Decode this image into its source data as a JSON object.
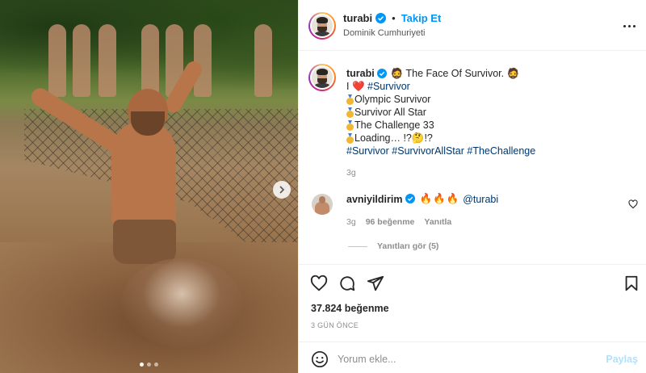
{
  "post": {
    "image_alt": "",
    "carousel": {
      "count": 3,
      "active_index": 0
    }
  },
  "header": {
    "username": "turabi",
    "separator": "•",
    "follow_label": "Takip Et",
    "location": "Dominik Cumhuriyeti",
    "more_icon": "more-horizontal-icon"
  },
  "caption": {
    "username": "turabi",
    "title": " The Face Of Survivor. ",
    "emoji_face": "🧔",
    "line_love_prefix": "I ",
    "heart": "❤️",
    "line_love_tag": "#Survivor",
    "medal_items": [
      "Olympic Survivor",
      "Survivor All Star",
      "The Challenge 33",
      "Loading… !?🤔!?"
    ],
    "hashtags": [
      "#Survivor",
      "#SurvivorAllStar",
      "#TheChallenge"
    ],
    "time": "3g"
  },
  "comment": {
    "username": "avniyildirim",
    "fire": "🔥🔥🔥",
    "mention": "@turabi",
    "time": "3g",
    "likes": "96 beğenme",
    "reply_label": "Yanıtla",
    "view_replies": "Yanıtları gör (5)"
  },
  "actions": {
    "likes": "37.824 beğenme",
    "date": "3 GÜN ÖNCE"
  },
  "add_comment": {
    "placeholder": "Yorum ekle...",
    "post_label": "Paylaş"
  },
  "colors": {
    "accent": "#0095f6",
    "hashtag": "#00376b",
    "muted": "#8e8e8e",
    "post_disabled": "#b2dffc"
  }
}
